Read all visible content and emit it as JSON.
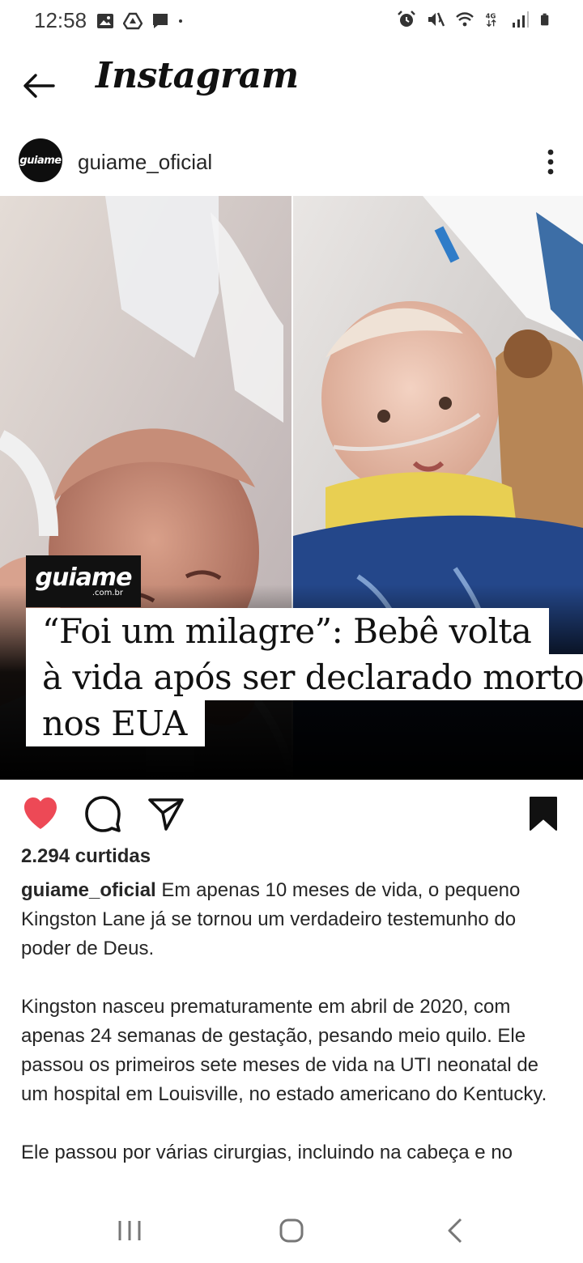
{
  "status_bar": {
    "time": "12:58",
    "left_icons": [
      "gallery-icon",
      "drive-icon",
      "message-icon",
      "dot-icon"
    ],
    "right_icons": [
      "alarm-icon",
      "mute-icon",
      "wifi-icon",
      "4g-icon",
      "signal-icon",
      "battery-icon"
    ]
  },
  "header": {
    "title": "Instagram"
  },
  "post": {
    "username": "guiame_oficial",
    "avatar_text": "guiame",
    "image": {
      "brand_main": "guiame",
      "brand_sub": ".com.br",
      "headline": [
        "“Foi um milagre”: Bebê volta",
        "à vida após ser declarado morto",
        "nos EUA"
      ]
    },
    "liked": true,
    "saved": true,
    "likes": "2.294 curtidas",
    "caption": {
      "username": "guiame_oficial",
      "paragraphs": [
        "Em apenas 10 meses de vida, o pequeno Kingston Lane já se tornou um verdadeiro testemunho do poder de Deus.",
        "Kingston nasceu prematuramente em abril de 2020, com apenas 24 semanas de gestação, pesando meio quilo. Ele passou os primeiros sete meses de vida na UTI neonatal de um hospital em Louisville, no estado americano do Kentucky.",
        "Ele passou por várias cirurgias, incluindo na cabeça e no"
      ]
    }
  },
  "colors": {
    "like_red": "#ed4956",
    "text": "#262626",
    "headline_bg": "#ffffff"
  },
  "nav": [
    "recents-icon",
    "home-icon",
    "back-icon"
  ]
}
